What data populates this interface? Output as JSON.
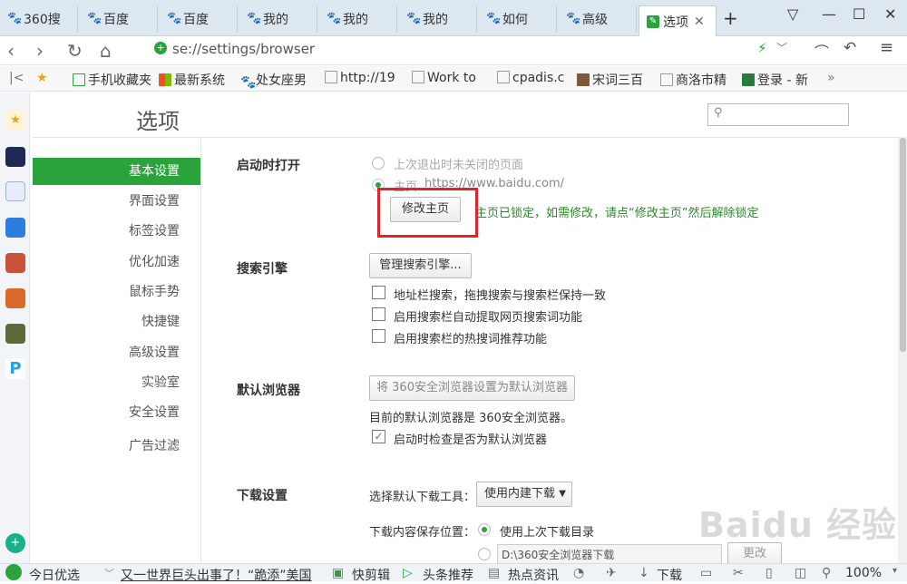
{
  "tabs": [
    {
      "label": "360搜"
    },
    {
      "label": "百度"
    },
    {
      "label": "百度"
    },
    {
      "label": "我的"
    },
    {
      "label": "我的"
    },
    {
      "label": "我的"
    },
    {
      "label": "如何"
    },
    {
      "label": "高级"
    },
    {
      "label": "选项",
      "active": true
    }
  ],
  "window": {
    "newtab": "+",
    "menu": "▽",
    "minimize": "—",
    "maximize": "☐",
    "close": "✕"
  },
  "nav": {
    "url": "se://settings/browser"
  },
  "bookmarks": [
    {
      "label": "手机收藏夹"
    },
    {
      "label": "最新系统"
    },
    {
      "label": "处女座男"
    },
    {
      "label": "http://19"
    },
    {
      "label": "Work to"
    },
    {
      "label": "cpadis.c"
    },
    {
      "label": "宋词三百"
    },
    {
      "label": "商洛市精"
    },
    {
      "label": "登录 - 新"
    }
  ],
  "page": {
    "title": "选项",
    "search_placeholder": ""
  },
  "sidebar": [
    {
      "label": "基本设置",
      "active": true
    },
    {
      "label": "界面设置"
    },
    {
      "label": "标签设置"
    },
    {
      "label": "优化加速"
    },
    {
      "label": "鼠标手势"
    },
    {
      "label": "快捷键"
    },
    {
      "label": "高级设置"
    },
    {
      "label": "实验室"
    },
    {
      "label": "安全设置"
    },
    {
      "label": "广告过滤"
    }
  ],
  "startup": {
    "heading": "启动时打开",
    "opt_last": "上次退出时未关闭的页面",
    "opt_home_prefix": "主页",
    "home_url": "https://www.baidu.com/",
    "btn_change_home": "修改主页",
    "lock_note": "主页已锁定，如需修改，请点“修改主页”然后解除锁定"
  },
  "search": {
    "heading": "搜索引擎",
    "btn_manage": "管理搜索引擎...",
    "opt1": "地址栏搜索，拖拽搜索与搜索栏保持一致",
    "opt2": "启用搜索栏自动提取网页搜索词功能",
    "opt3": "启用搜索栏的热搜词推荐功能"
  },
  "default_browser": {
    "heading": "默认浏览器",
    "btn_set": "将 360安全浏览器设置为默认浏览器",
    "status": "目前的默认浏览器是 360安全浏览器。",
    "opt_check": "启动时检查是否为默认浏览器"
  },
  "download": {
    "heading": "下载设置",
    "tool_label": "选择默认下载工具：",
    "tool_value": "使用内建下载",
    "save_label": "下载内容保存位置：",
    "opt_last_dir": "使用上次下载目录",
    "path": "D:\\360安全浏览器下载",
    "btn_change": "更改"
  },
  "statusbar": {
    "today": "今日优选",
    "headline": "又一世界巨头出事了！“跪添”美国",
    "clip": "快剪辑",
    "headlines": "头条推荐",
    "hotnews": "热点资讯",
    "download": "下载",
    "zoom": "100%"
  },
  "watermark": "Baidu 经验",
  "colors": {
    "accent": "#2ba33b",
    "highlight_box": "#e0242b",
    "note_text": "#2a8a2a"
  }
}
